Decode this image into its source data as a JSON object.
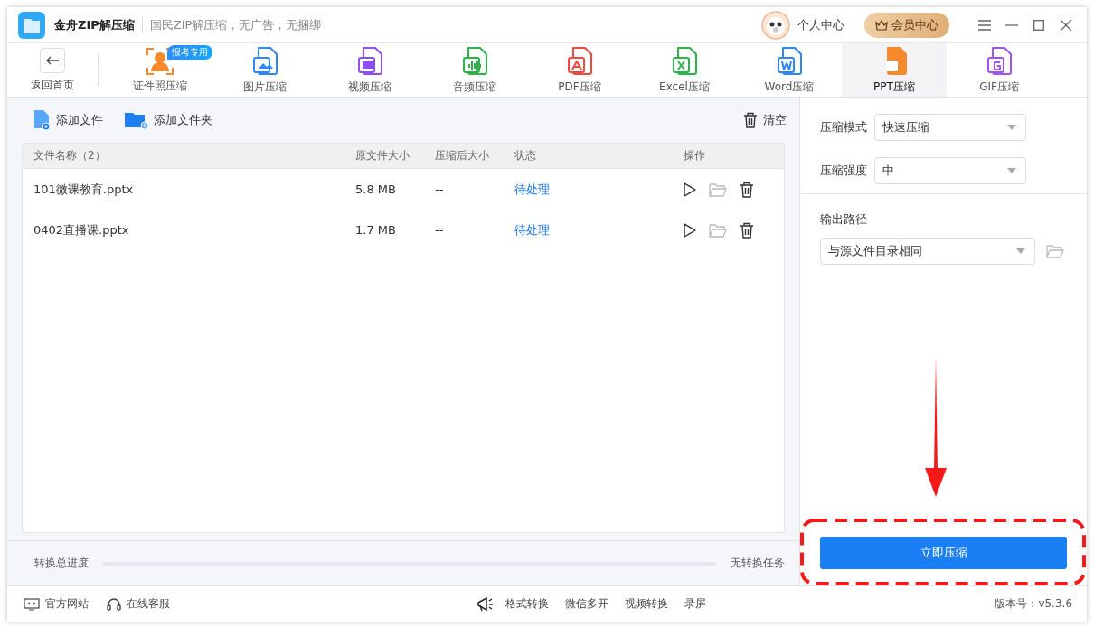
{
  "app": {
    "name": "金舟ZIP解压缩",
    "slogan": "国民ZIP解压缩，无广告，无捆绑"
  },
  "header": {
    "profile": "个人中心",
    "vip": "会员中心"
  },
  "back": {
    "label": "返回首页"
  },
  "tools": [
    {
      "kind": "idphoto",
      "label": "证件照压缩",
      "selected": false,
      "badge": "报考专用"
    },
    {
      "kind": "image",
      "label": "图片压缩",
      "selected": false
    },
    {
      "kind": "video",
      "label": "视频压缩",
      "selected": false
    },
    {
      "kind": "audio",
      "label": "音频压缩",
      "selected": false
    },
    {
      "kind": "pdf",
      "label": "PDF压缩",
      "selected": false
    },
    {
      "kind": "excel",
      "label": "Excel压缩",
      "selected": false
    },
    {
      "kind": "word",
      "label": "Word压缩",
      "selected": false
    },
    {
      "kind": "ppt",
      "label": "PPT压缩",
      "selected": true
    },
    {
      "kind": "gif",
      "label": "GIF压缩",
      "selected": false
    }
  ],
  "actions": {
    "add_file": "添加文件",
    "add_folder": "添加文件夹",
    "clear": "清空"
  },
  "table": {
    "columns": [
      "文件名称（2）",
      "原文件大小",
      "压缩后大小",
      "状态",
      "操作"
    ],
    "rows": [
      {
        "name": "101微课教育.pptx",
        "size": "5.8 MB",
        "compressed": "--",
        "status": "待处理"
      },
      {
        "name": "0402直播课.pptx",
        "size": "1.7 MB",
        "compressed": "--",
        "status": "待处理"
      }
    ]
  },
  "progress": {
    "label": "转换总进度",
    "status": "无转换任务"
  },
  "settings": {
    "mode_label": "压缩模式",
    "mode": "快速压缩",
    "strength_label": "压缩强度",
    "strength": "中",
    "output_label": "输出路径",
    "output": "与源文件目录相同"
  },
  "start_button": "立即压缩",
  "footer": {
    "links": [
      {
        "kind": "web",
        "label": "官方网站"
      },
      {
        "kind": "support",
        "label": "在线客服"
      }
    ],
    "promo": [
      "格式转换",
      "微信多开",
      "视频转换",
      "录屏"
    ],
    "version": "版本号：v5.3.6"
  }
}
